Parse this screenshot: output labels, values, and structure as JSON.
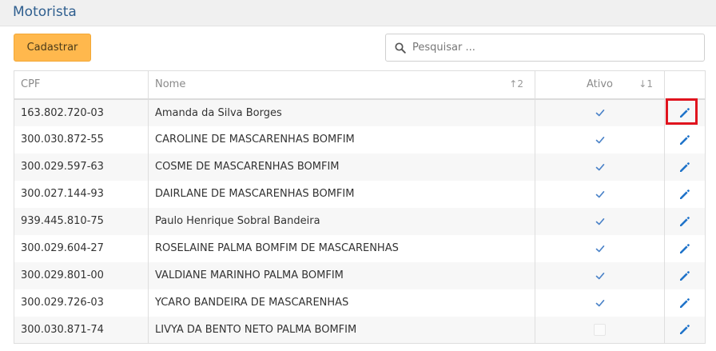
{
  "page": {
    "title": "Motorista"
  },
  "toolbar": {
    "add_label": "Cadastrar"
  },
  "search": {
    "placeholder": "Pesquisar ..."
  },
  "table": {
    "headers": {
      "cpf": "CPF",
      "nome": "Nome",
      "nome_sort": "↑2",
      "ativo": "Ativo",
      "ativo_sort": "↓1"
    },
    "rows": [
      {
        "cpf": "163.802.720-03",
        "nome": "Amanda da Silva Borges",
        "ativo": true
      },
      {
        "cpf": "300.030.872-55",
        "nome": "CAROLINE DE MASCARENHAS BOMFIM",
        "ativo": true
      },
      {
        "cpf": "300.029.597-63",
        "nome": "COSME DE MASCARENHAS BOMFIM",
        "ativo": true
      },
      {
        "cpf": "300.027.144-93",
        "nome": "DAIRLANE DE MASCARENHAS BOMFIM",
        "ativo": true
      },
      {
        "cpf": "939.445.810-75",
        "nome": "Paulo Henrique Sobral Bandeira",
        "ativo": true
      },
      {
        "cpf": "300.029.604-27",
        "nome": "ROSELAINE PALMA BOMFIM DE MASCARENHAS",
        "ativo": true
      },
      {
        "cpf": "300.029.801-00",
        "nome": "VALDIANE MARINHO PALMA BOMFIM",
        "ativo": true
      },
      {
        "cpf": "300.029.726-03",
        "nome": "YCARO BANDEIRA DE MASCARENHAS",
        "ativo": true
      },
      {
        "cpf": "300.030.871-74",
        "nome": "LIVYA DA BENTO NETO PALMA BOMFIM",
        "ativo": false
      }
    ]
  },
  "icons": {
    "search": "search-icon",
    "edit": "pencil-icon",
    "check": "check-icon"
  },
  "colors": {
    "accent": "#ffb84d",
    "title": "#2f5f8f",
    "edit": "#1f73c9",
    "check": "#4a82c8",
    "highlight": "#e0141e"
  }
}
